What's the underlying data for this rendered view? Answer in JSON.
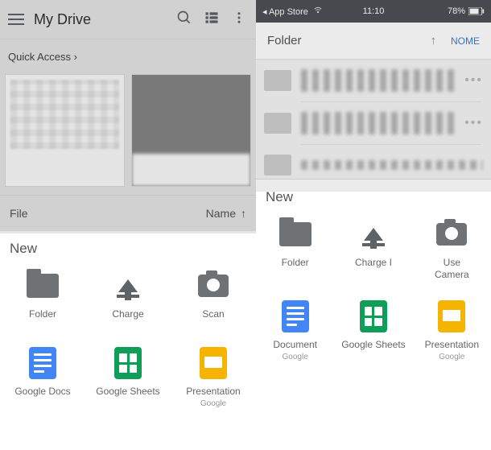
{
  "left": {
    "header": {
      "title": "My Drive"
    },
    "quick_access": "Quick Access ›",
    "file_label": "File",
    "sort_label": "Name",
    "sheet": {
      "title": "New",
      "row1": [
        {
          "label": "Folder"
        },
        {
          "label": "Charge"
        },
        {
          "label": "Scan"
        }
      ],
      "row2": [
        {
          "label": "Google Docs"
        },
        {
          "label": "Google Sheets"
        },
        {
          "label": "Presentation",
          "sub": "Google"
        }
      ]
    }
  },
  "right": {
    "status": {
      "left": "◂ App Store",
      "wifi": "⋮",
      "time": "11:10",
      "battery": "78%"
    },
    "header": {
      "title": "Folder",
      "sort": "NOME"
    },
    "sheet": {
      "title": "New",
      "row1": [
        {
          "label": "Folder"
        },
        {
          "label": "Charge I"
        },
        {
          "label": "Use\nCamera"
        }
      ],
      "row2": [
        {
          "label": "Document",
          "sub": "Google"
        },
        {
          "label": "Google Sheets"
        },
        {
          "label": "Presentation",
          "sub": "Google"
        }
      ]
    }
  }
}
